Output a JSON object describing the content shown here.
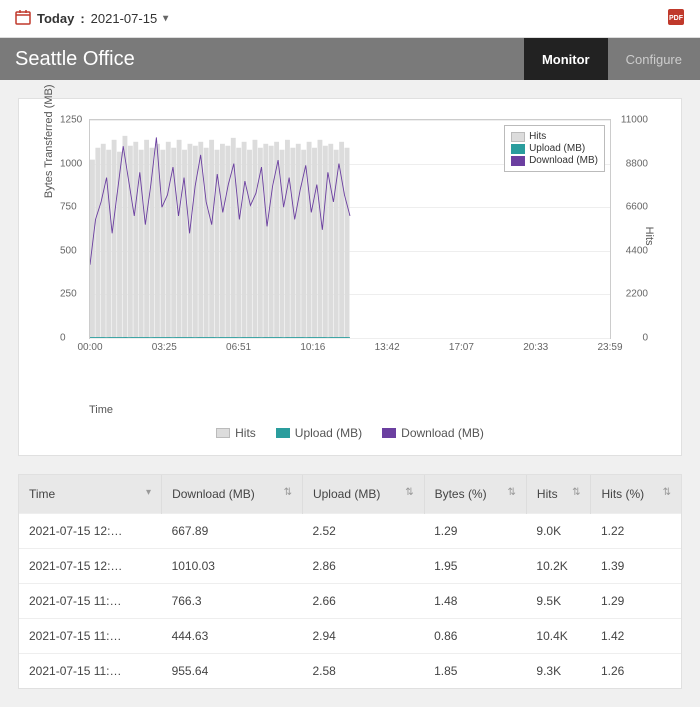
{
  "header": {
    "today_label": "Today",
    "date": "2021-07-15"
  },
  "page": {
    "title": "Seattle Office",
    "tabs": {
      "monitor": "Monitor",
      "configure": "Configure"
    }
  },
  "chart_data": {
    "type": "line",
    "xlabel": "Time",
    "ylabel_left": "Bytes Transferred (MB)",
    "ylabel_right": "Hits",
    "ylim_left": [
      0,
      1250
    ],
    "ylim_right": [
      0,
      11000
    ],
    "ticks_left": [
      0,
      250,
      500,
      750,
      1000,
      1250
    ],
    "ticks_right": [
      0,
      2200,
      4400,
      6600,
      8800,
      11000
    ],
    "x_ticks": [
      "00:00",
      "03:25",
      "06:51",
      "10:16",
      "13:42",
      "17:07",
      "20:33",
      "23:59"
    ],
    "legend": [
      "Hits",
      "Upload (MB)",
      "Download (MB)"
    ],
    "colors": {
      "hits": "#dcdcdc",
      "upload": "#2a9d9d",
      "download": "#6b3fa0"
    },
    "series": [
      {
        "name": "Hits",
        "values": [
          9000,
          9600,
          9800,
          9500,
          10000,
          9400,
          10200,
          9700,
          9900,
          9500,
          10000,
          9600,
          9800,
          9500,
          9900,
          9600,
          10000,
          9500,
          9800,
          9700,
          9900,
          9600,
          10000,
          9500,
          9800,
          9700,
          10100,
          9600,
          9900,
          9500,
          10000,
          9600,
          9800,
          9700,
          9900,
          9500,
          10000,
          9600,
          9800,
          9500,
          9900,
          9600,
          10000,
          9700,
          9800,
          9500,
          9900,
          9600
        ]
      },
      {
        "name": "Upload (MB)",
        "values": [
          3,
          3,
          3,
          2,
          3,
          3,
          3,
          2,
          3,
          3,
          3,
          2,
          3,
          3,
          3,
          2,
          3,
          3,
          3,
          2,
          3,
          3,
          3,
          2,
          3,
          3,
          3,
          2,
          3,
          3,
          3,
          2,
          3,
          3,
          3,
          2,
          3,
          3,
          3,
          2,
          3,
          3,
          3,
          2,
          3,
          3,
          3,
          2
        ]
      },
      {
        "name": "Download (MB)",
        "values": [
          420,
          680,
          780,
          920,
          600,
          850,
          1100,
          900,
          700,
          950,
          650,
          880,
          1150,
          750,
          820,
          980,
          700,
          920,
          600,
          870,
          1050,
          780,
          650,
          940,
          720,
          880,
          1000,
          680,
          900,
          760,
          830,
          980,
          640,
          870,
          1020,
          750,
          920,
          680,
          850,
          990,
          720,
          880,
          620,
          950,
          780,
          1000,
          820,
          700
        ]
      }
    ]
  },
  "table": {
    "columns": [
      "Time",
      "Download (MB)",
      "Upload (MB)",
      "Bytes (%)",
      "Hits",
      "Hits (%)"
    ],
    "rows": [
      {
        "time": "2021-07-15 12:…",
        "download": "667.89",
        "upload": "2.52",
        "bytes_pct": "1.29",
        "hits": "9.0K",
        "hits_pct": "1.22"
      },
      {
        "time": "2021-07-15 12:…",
        "download": "1010.03",
        "upload": "2.86",
        "bytes_pct": "1.95",
        "hits": "10.2K",
        "hits_pct": "1.39"
      },
      {
        "time": "2021-07-15 11:…",
        "download": "766.3",
        "upload": "2.66",
        "bytes_pct": "1.48",
        "hits": "9.5K",
        "hits_pct": "1.29"
      },
      {
        "time": "2021-07-15 11:…",
        "download": "444.63",
        "upload": "2.94",
        "bytes_pct": "0.86",
        "hits": "10.4K",
        "hits_pct": "1.42"
      },
      {
        "time": "2021-07-15 11:…",
        "download": "955.64",
        "upload": "2.58",
        "bytes_pct": "1.85",
        "hits": "9.3K",
        "hits_pct": "1.26"
      }
    ]
  }
}
